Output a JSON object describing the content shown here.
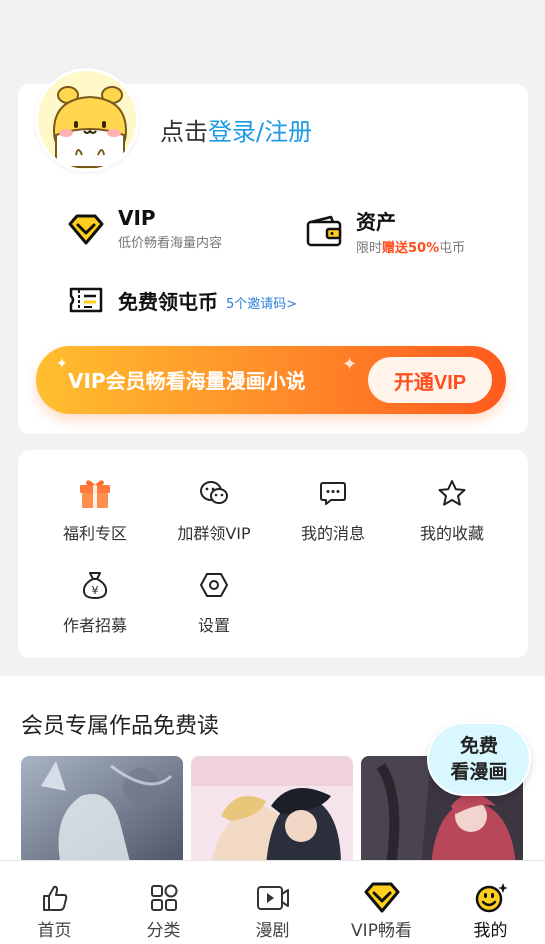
{
  "profile": {
    "login_prefix": "点击",
    "login_link": "登录/注册"
  },
  "features": {
    "vip": {
      "title": "VIP",
      "subtitle": "低价畅看海量内容"
    },
    "assets": {
      "title": "资产",
      "subtitle_prefix": "限时",
      "subtitle_highlight": "赠送50%",
      "subtitle_suffix": "屯币"
    },
    "coins": {
      "title": "免费领屯币",
      "invite": "5个邀请码>"
    }
  },
  "vip_banner": {
    "text": "VIP会员畅看海量漫画小说",
    "button": "开通VIP"
  },
  "menu": [
    {
      "label": "福利专区",
      "icon": "gift-icon"
    },
    {
      "label": "加群领VIP",
      "icon": "wechat-icon"
    },
    {
      "label": "我的消息",
      "icon": "message-icon"
    },
    {
      "label": "我的收藏",
      "icon": "star-icon"
    },
    {
      "label": "作者招募",
      "icon": "money-bag-icon"
    },
    {
      "label": "设置",
      "icon": "settings-icon"
    }
  ],
  "section": {
    "title": "会员专属作品免费读"
  },
  "free_badge": {
    "line1": "免费",
    "line2": "看漫画"
  },
  "tabs": [
    {
      "label": "首页",
      "icon": "thumbs-up-icon"
    },
    {
      "label": "分类",
      "icon": "category-icon"
    },
    {
      "label": "漫剧",
      "icon": "video-icon"
    },
    {
      "label": "VIP畅看",
      "icon": "vip-diamond-icon"
    },
    {
      "label": "我的",
      "icon": "smiley-icon",
      "active": true
    }
  ],
  "colors": {
    "accent_blue": "#1e9be6",
    "accent_orange": "#ff5a1e",
    "vip_yellow": "#ffcf1f"
  }
}
